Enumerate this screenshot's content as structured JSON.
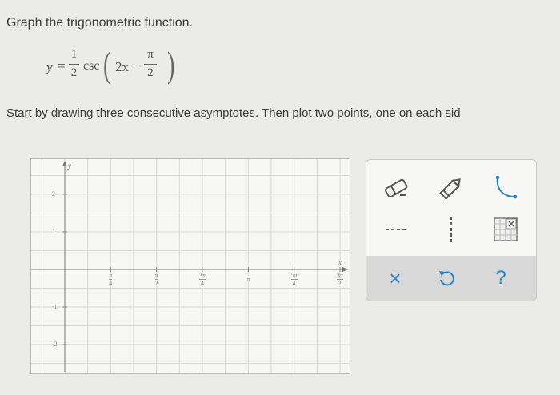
{
  "question": {
    "prompt": "Graph the trigonometric function.",
    "equation": {
      "lhs": "y",
      "equals": "=",
      "coef_num": "1",
      "coef_den": "2",
      "func": "csc",
      "arg_term": "2x",
      "minus": "−",
      "shift_num": "π",
      "shift_den": "2"
    },
    "instruction": "Start by drawing three consecutive asymptotes. Then plot two points, one on each sid"
  },
  "graph": {
    "x_axis_letter": "x",
    "y_axis_letter": "y",
    "y_ticks": [
      {
        "label": "2",
        "value": 2
      },
      {
        "label": "1",
        "value": 1
      },
      {
        "label": "-1",
        "value": -1
      },
      {
        "label": "-2",
        "value": -2
      }
    ],
    "x_ticks": [
      {
        "num": "π",
        "den": "4",
        "value": 0.785
      },
      {
        "num": "π",
        "den": "2",
        "value": 1.571
      },
      {
        "num": "3π",
        "den": "4",
        "value": 2.356
      },
      {
        "num": "",
        "den": "",
        "label": "π",
        "value": 3.142
      },
      {
        "num": "5π",
        "den": "4",
        "value": 3.927
      },
      {
        "num": "3π",
        "den": "2",
        "value": 4.712
      }
    ]
  },
  "tools": {
    "eraser": "eraser-icon",
    "pencil": "pencil-icon",
    "curve": "curve-icon",
    "dashed_h": "dashed-horizontal-line-icon",
    "dashed_v": "dashed-vertical-line-icon",
    "grid": "grid-icon",
    "clear": "×",
    "undo": "undo-icon",
    "help": "?"
  },
  "colors": {
    "accent": "#2a83c4",
    "tool_gray": "#555555"
  }
}
